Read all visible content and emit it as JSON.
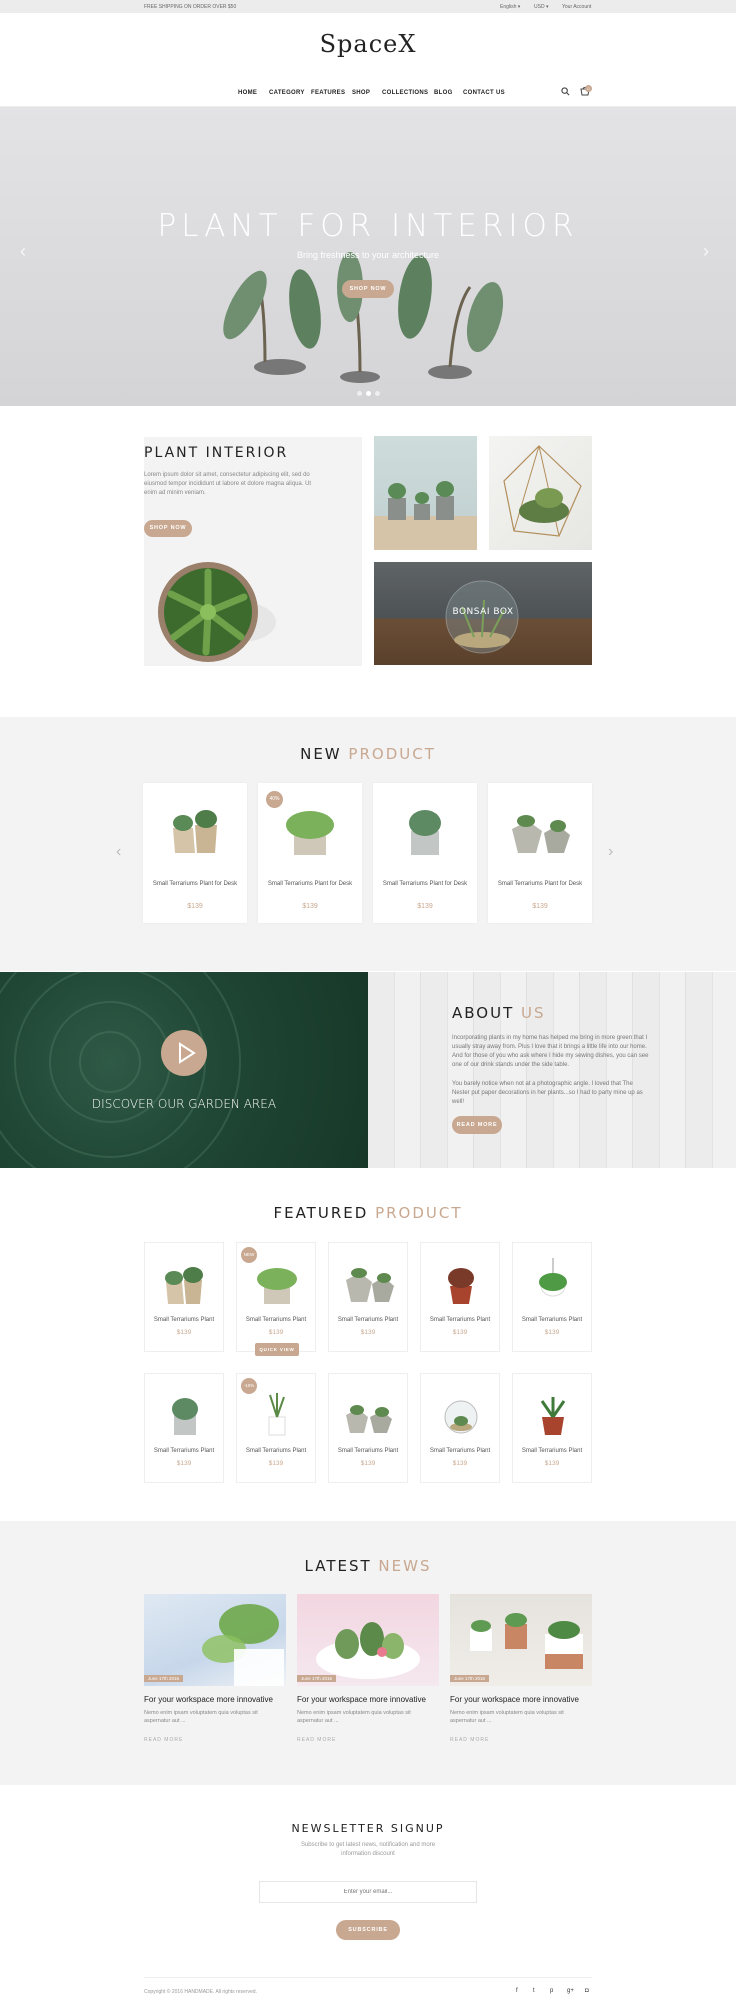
{
  "topbar": {
    "shipping": "FREE SHIPPING ON ORDER OVER $50",
    "language": "English ▾",
    "currency": "USD ▾",
    "account": "Your Account"
  },
  "brand": {
    "logo": "SpaceX"
  },
  "nav": [
    "HOME",
    "CATEGORY",
    "FEATURES",
    "SHOP",
    "COLLECTIONS",
    "BLOG",
    "CONTACT US"
  ],
  "cart": {
    "count": "0"
  },
  "hero": {
    "title": "PLANT FOR INTERIOR",
    "subtitle": "Bring freshness to your architecture",
    "button": "SHOP NOW"
  },
  "interior": {
    "title": "PLANT INTERIOR",
    "text": "Lorem ipsum dolor sit amet, consectetur adipiscing elit, sed do eiusmod tempor incididunt ut labore et dolore magna aliqua. Ut enim ad minim veniam.",
    "button": "SHOP NOW",
    "bonsai": "BONSAI BOX"
  },
  "new_product": {
    "title_a": "NEW",
    "title_b": "PRODUCT",
    "items": [
      {
        "name": "Small Terrariums Plant for Desk",
        "price": "$139",
        "badge": ""
      },
      {
        "name": "Small Terrariums Plant for Desk",
        "price": "$139",
        "badge": "40%"
      },
      {
        "name": "Small Terrariums Plant for Desk",
        "price": "$139",
        "badge": ""
      },
      {
        "name": "Small Terrariums Plant for Desk",
        "price": "$139",
        "badge": ""
      }
    ]
  },
  "garden": {
    "label": "DISCOVER OUR GARDEN AREA"
  },
  "about": {
    "title_a": "ABOUT",
    "title_b": "US",
    "p1": "Incorporating plants in my home has helped me bring in more green that I usually stray away from. Plus I love that it brings a little life into our home. And for those of you who ask where I hide my sewing dishes, you can see one of our drink stands under the side table.",
    "p2": "You barely notice when not at a photographic angle. I loved that The Nester put paper decorations in her plants...so I had to party mine up as well!",
    "button": "READ MORE"
  },
  "featured": {
    "title_a": "FEATURED",
    "title_b": "PRODUCT",
    "quick_view": "QUICK VIEW",
    "items": [
      {
        "name": "Small Terrariums Plant",
        "price": "$139",
        "badge": ""
      },
      {
        "name": "Small Terrariums Plant",
        "price": "$139",
        "badge": "NEW"
      },
      {
        "name": "Small Terrariums Plant",
        "price": "$139",
        "badge": ""
      },
      {
        "name": "Small Terrariums Plant",
        "price": "$139",
        "badge": ""
      },
      {
        "name": "Small Terrariums Plant",
        "price": "$139",
        "badge": ""
      },
      {
        "name": "Small Terrariums Plant",
        "price": "$139",
        "badge": ""
      },
      {
        "name": "Small Terrariums Plant",
        "price": "$139",
        "badge": "-10%"
      },
      {
        "name": "Small Terrariums Plant",
        "price": "$139",
        "badge": ""
      },
      {
        "name": "Small Terrariums Plant",
        "price": "$139",
        "badge": ""
      },
      {
        "name": "Small Terrariums Plant",
        "price": "$139",
        "badge": ""
      }
    ]
  },
  "news": {
    "title_a": "LATEST",
    "title_b": "NEWS",
    "items": [
      {
        "date": "June 17th 2016",
        "title": "For your workspace more innovative",
        "excerpt": "Nemo enim ipsam voluptatem quia voluptas sit aspernatur aut ...",
        "more": "READ MORE"
      },
      {
        "date": "June 17th 2016",
        "title": "For your workspace more innovative",
        "excerpt": "Nemo enim ipsam voluptatem quia voluptas sit aspernatur aut ...",
        "more": "READ MORE"
      },
      {
        "date": "June 17th 2016",
        "title": "For your workspace more innovative",
        "excerpt": "Nemo enim ipsam voluptatem quia voluptas sit aspernatur aut ...",
        "more": "READ MORE"
      }
    ]
  },
  "newsletter": {
    "title": "NEWSLETTER SIGNUP",
    "text": "Subscribe to get latest news, notification and more information discount",
    "placeholder": "Enter your email...",
    "button": "SUBSCRIBE"
  },
  "footer": {
    "copyright": "Copyright © 2016 HANDMADE. All rights reserved."
  },
  "colors": {
    "accent": "#c8a890",
    "dark_green": "#1f4534",
    "grey_bg": "#f3f3f3"
  }
}
